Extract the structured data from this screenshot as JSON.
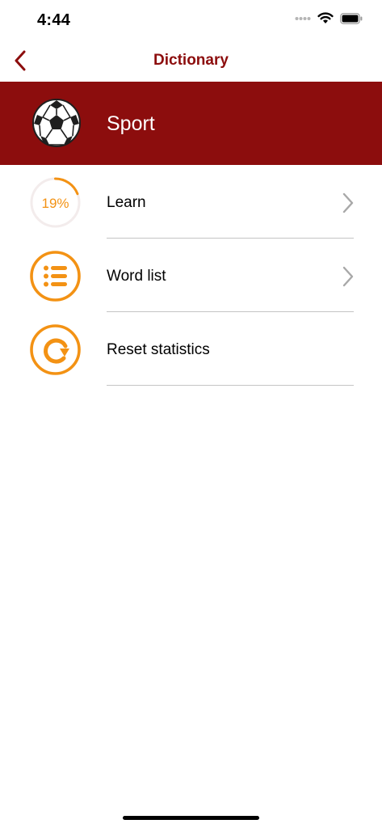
{
  "status_bar": {
    "time": "4:44"
  },
  "nav": {
    "title": "Dictionary",
    "back_icon": "chevron-left-icon"
  },
  "category": {
    "title": "Sport",
    "icon": "soccer-ball-icon"
  },
  "menu": [
    {
      "label": "Learn",
      "icon": "progress-ring-icon",
      "progress_text": "19%",
      "progress_value": 0.19,
      "has_chevron": true
    },
    {
      "label": "Word list",
      "icon": "list-icon",
      "has_chevron": true
    },
    {
      "label": "Reset statistics",
      "icon": "reset-icon",
      "has_chevron": false
    }
  ],
  "colors": {
    "brand": "#8c0d0d",
    "accent": "#f39214",
    "divider": "#c4c4c4",
    "chevron": "#a8a8a8"
  }
}
